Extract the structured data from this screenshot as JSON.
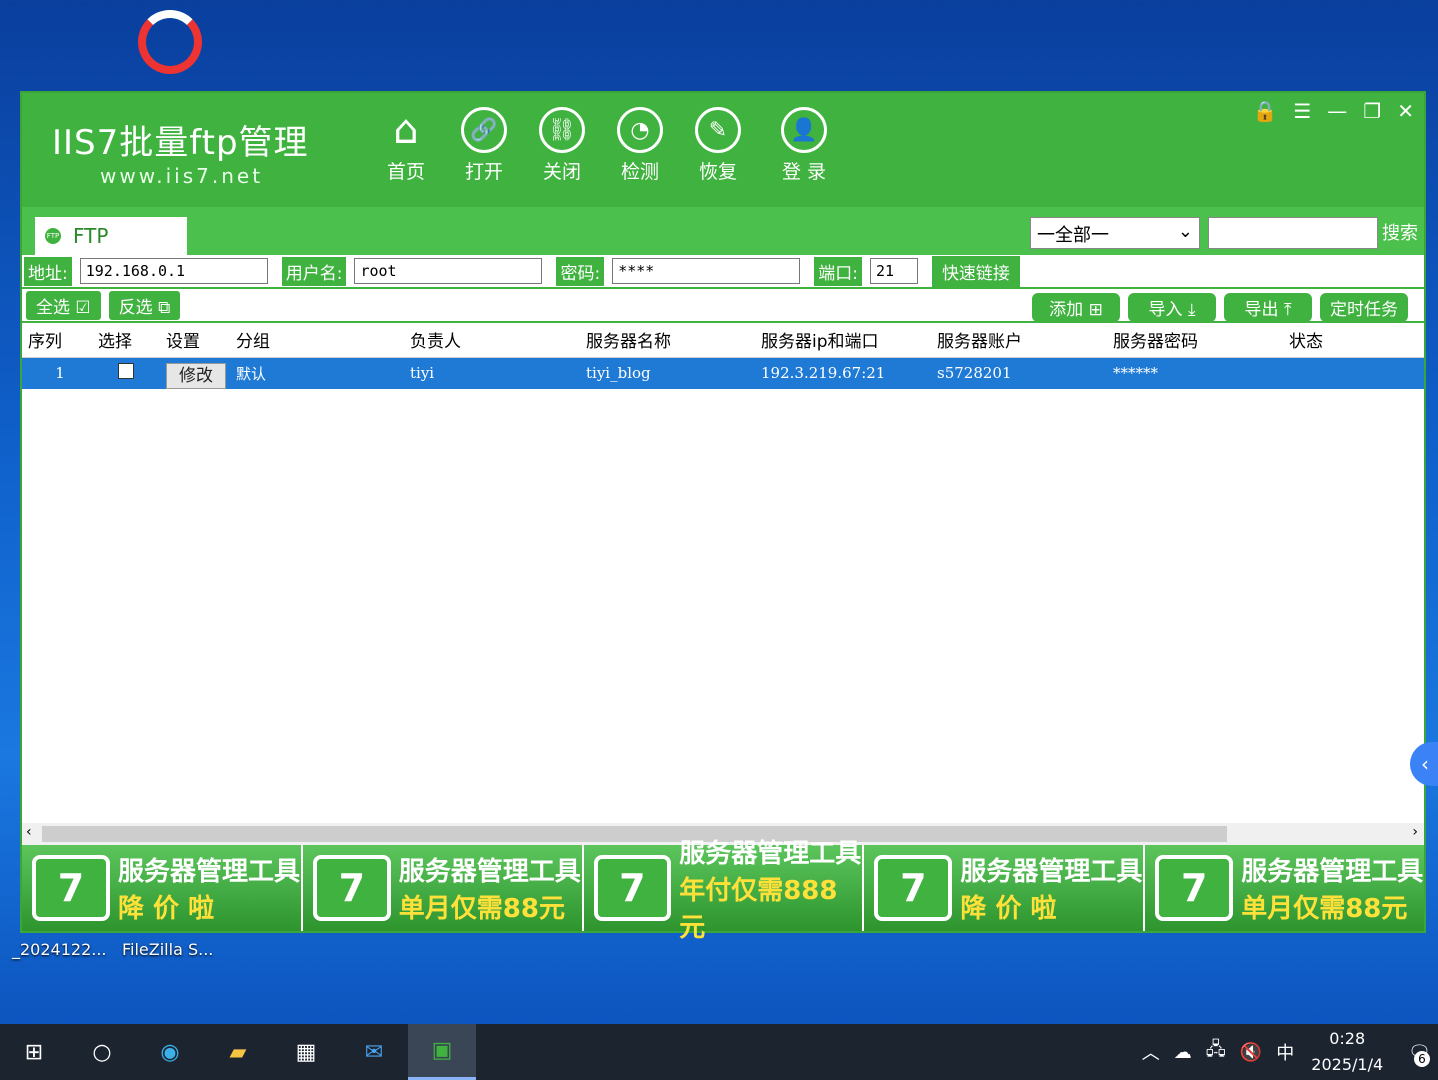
{
  "desktop": {
    "icon_label_1": "_2024122...",
    "icon_label_2": "FileZilla S..."
  },
  "app": {
    "logo_title": "IIS7批量ftp管理",
    "logo_url": "www.iis7.net",
    "nav": [
      "首页",
      "打开",
      "关闭",
      "检测",
      "恢复",
      "登 录"
    ],
    "tab": "FTP",
    "filter_value": "一全部一",
    "search_label": "搜索",
    "form": {
      "addr_label": "地址:",
      "addr_value": "192.168.0.1",
      "user_label": "用户名:",
      "user_value": "root",
      "pwd_label": "密码:",
      "pwd_value": "****",
      "port_label": "端口:",
      "port_value": "21",
      "quick_link": "快速链接"
    },
    "actions": {
      "select_all": "全选",
      "invert": "反选",
      "add": "添加",
      "import": "导入",
      "export": "导出",
      "schedule": "定时任务"
    },
    "table": {
      "headers": [
        "序列",
        "选择",
        "设置",
        "分组",
        "负责人",
        "服务器名称",
        "服务器ip和端口",
        "服务器账户",
        "服务器密码",
        "状态"
      ],
      "rows": [
        {
          "seq": "1",
          "edit": "修改",
          "group": "默认",
          "owner": "tiyi",
          "name": "tiyi_blog",
          "ip": "192.3.219.67:21",
          "account": "s5728201",
          "password": "******",
          "status": ""
        }
      ]
    },
    "banners": [
      {
        "logo": "7",
        "line1": "服务器管理工具",
        "line2": "降 价 啦"
      },
      {
        "logo": "7",
        "line1": "服务器管理工具",
        "line2": "单月仅需88元"
      },
      {
        "logo": "7",
        "line1": "服务器管理工具",
        "line2": "年付仅需888元"
      },
      {
        "logo": "7",
        "line1": "服务器管理工具",
        "line2": "降 价 啦"
      },
      {
        "logo": "7",
        "line1": "服务器管理工具",
        "line2": "单月仅需88元"
      }
    ]
  },
  "taskbar": {
    "ime": "中",
    "time": "0:28",
    "date": "2025/1/4",
    "notif_count": "6"
  }
}
